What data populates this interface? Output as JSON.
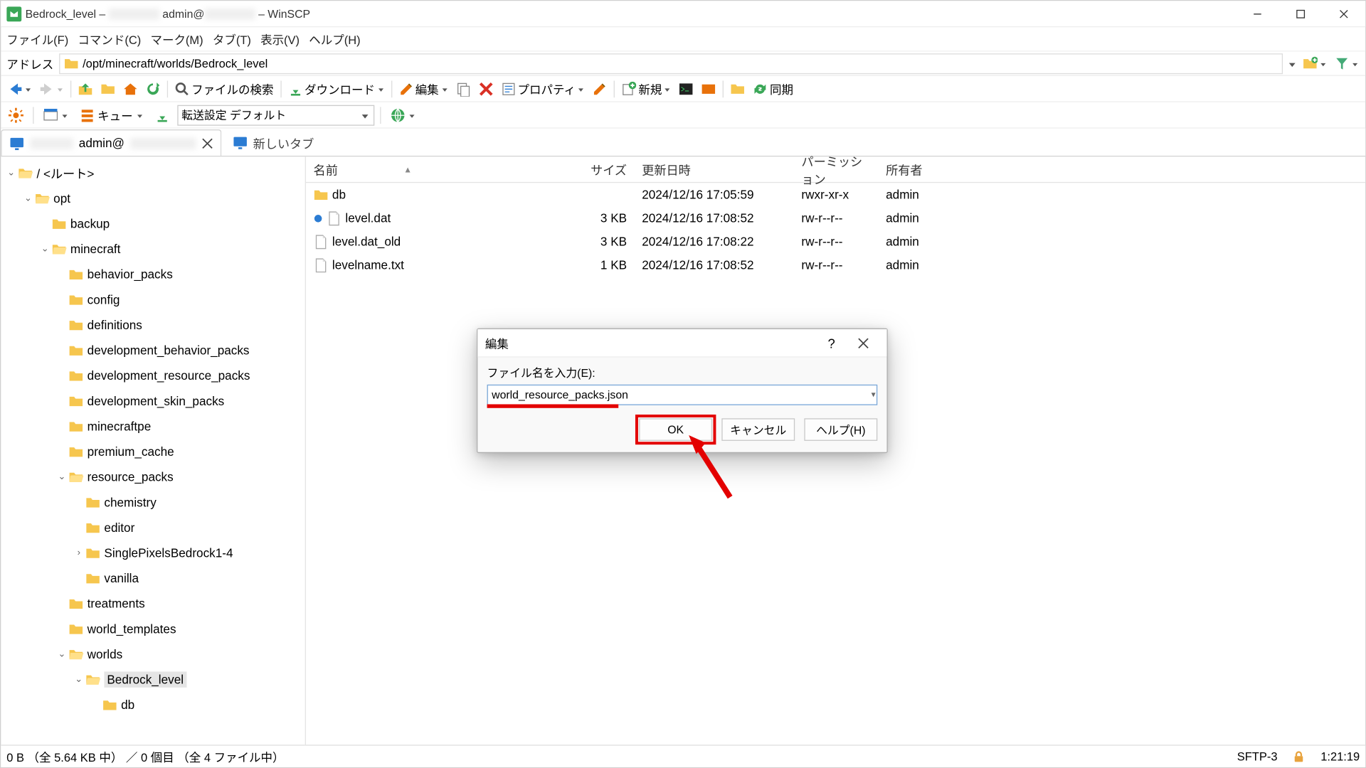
{
  "title": {
    "left": "Bedrock_level – ",
    "mid": "admin@",
    "suffix": " – WinSCP"
  },
  "menu": [
    "ファイル(F)",
    "コマンド(C)",
    "マーク(M)",
    "タブ(T)",
    "表示(V)",
    "ヘルプ(H)"
  ],
  "address": {
    "label": "アドレス",
    "path": "/opt/minecraft/worlds/Bedrock_level"
  },
  "toolbar1": {
    "search": "ファイルの検索",
    "download": "ダウンロード",
    "edit": "編集",
    "properties": "プロパティ",
    "new": "新規",
    "sync": "同期"
  },
  "toolbar2": {
    "queue": "キュー",
    "transfer_label": "転送設定",
    "transfer_value": "デフォルト"
  },
  "tabs": {
    "active_mid": "admin@",
    "new_tab": "新しいタブ"
  },
  "tree": [
    {
      "l": 0,
      "exp": "v",
      "label": "/ <ルート>"
    },
    {
      "l": 1,
      "exp": "v",
      "label": "opt"
    },
    {
      "l": 2,
      "exp": "",
      "label": "backup"
    },
    {
      "l": 2,
      "exp": "v",
      "label": "minecraft"
    },
    {
      "l": 3,
      "exp": "",
      "label": "behavior_packs"
    },
    {
      "l": 3,
      "exp": "",
      "label": "config"
    },
    {
      "l": 3,
      "exp": "",
      "label": "definitions"
    },
    {
      "l": 3,
      "exp": "",
      "label": "development_behavior_packs"
    },
    {
      "l": 3,
      "exp": "",
      "label": "development_resource_packs"
    },
    {
      "l": 3,
      "exp": "",
      "label": "development_skin_packs"
    },
    {
      "l": 3,
      "exp": "",
      "label": "minecraftpe"
    },
    {
      "l": 3,
      "exp": "",
      "label": "premium_cache"
    },
    {
      "l": 3,
      "exp": "v",
      "label": "resource_packs"
    },
    {
      "l": 4,
      "exp": "",
      "label": "chemistry"
    },
    {
      "l": 4,
      "exp": "",
      "label": "editor"
    },
    {
      "l": 4,
      "exp": ">",
      "label": "SinglePixelsBedrock1-4"
    },
    {
      "l": 4,
      "exp": "",
      "label": "vanilla"
    },
    {
      "l": 3,
      "exp": "",
      "label": "treatments"
    },
    {
      "l": 3,
      "exp": "",
      "label": "world_templates"
    },
    {
      "l": 3,
      "exp": "v",
      "label": "worlds"
    },
    {
      "l": 4,
      "exp": "v",
      "label": "Bedrock_level",
      "sel": true
    },
    {
      "l": 5,
      "exp": "",
      "label": "db"
    }
  ],
  "cols": {
    "name": "名前",
    "size": "サイズ",
    "date": "更新日時",
    "perm": "パーミッション",
    "owner": "所有者"
  },
  "files": [
    {
      "t": "dir",
      "name": "db",
      "size": "",
      "date": "2024/12/16 17:05:59",
      "perm": "rwxr-xr-x",
      "owner": "admin"
    },
    {
      "t": "file",
      "name": "level.dat",
      "size": "3 KB",
      "date": "2024/12/16 17:08:52",
      "perm": "rw-r--r--",
      "owner": "admin",
      "mark": true
    },
    {
      "t": "file",
      "name": "level.dat_old",
      "size": "3 KB",
      "date": "2024/12/16 17:08:22",
      "perm": "rw-r--r--",
      "owner": "admin"
    },
    {
      "t": "file",
      "name": "levelname.txt",
      "size": "1 KB",
      "date": "2024/12/16 17:08:52",
      "perm": "rw-r--r--",
      "owner": "admin"
    }
  ],
  "status": {
    "left": "0 B （全 5.64 KB 中） ／ 0 個目 （全 4 ファイル中）",
    "proto": "SFTP-3",
    "time": "1:21:19"
  },
  "dialog": {
    "title": "編集",
    "help": "?",
    "label": "ファイル名を入力(E):",
    "value": "world_resource_packs.json",
    "ok": "OK",
    "cancel": "キャンセル",
    "helpbtn": "ヘルプ(H)"
  }
}
